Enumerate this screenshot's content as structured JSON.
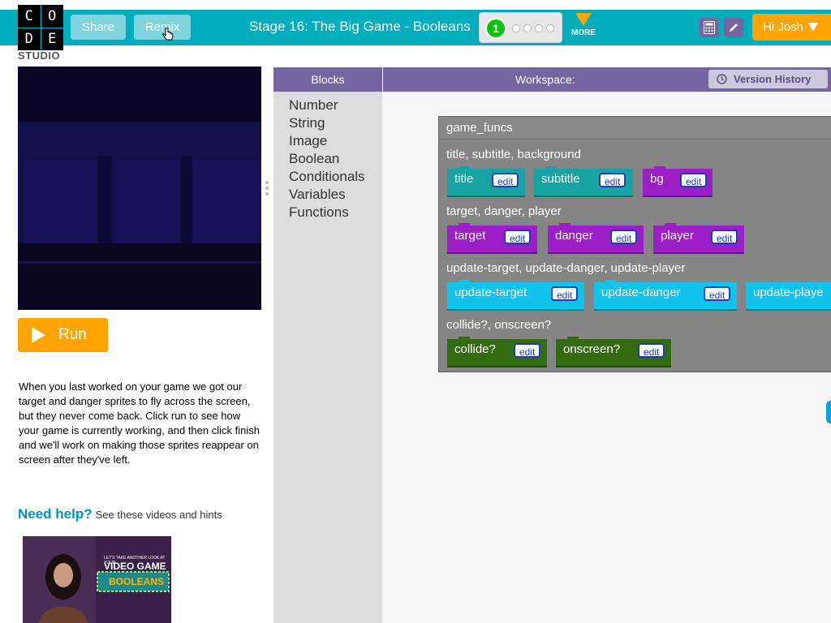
{
  "header": {
    "logo_letters": [
      "C",
      "O",
      "D",
      "E"
    ],
    "studio": "STUDIO",
    "share_label": "Share",
    "remix_label": "Remix",
    "stage_title": "Stage 16: The Big Game - Booleans",
    "progress_current": "1",
    "more_label": "MORE",
    "user_label": "Hi Josh",
    "colors": {
      "header_bg": "#00adbc",
      "accent_orange": "#ffa400",
      "purple": "#7665a0",
      "current_dot": "#0dc20d"
    }
  },
  "left": {
    "run_label": "Run",
    "instructions": "When you last worked on your game we got our target and danger sprites to fly across the screen, but they never come back. Click run to see how your game is currently working, and then click finish and we'll work on making those sprites reappear on screen after they've left.",
    "help_title": "Need help?",
    "help_sub": "See these videos and hints",
    "video": {
      "caption_line1": "LET'S TAKE ANOTHER LOOK AT YOUR",
      "caption_line2": "VIDEO GAME",
      "caption_line3": "BOOLEANS"
    }
  },
  "palette": {
    "header": "Blocks",
    "items": [
      "Number",
      "String",
      "Image",
      "Boolean",
      "Conditionals",
      "Variables",
      "Functions"
    ]
  },
  "workspace": {
    "header": "Workspace:",
    "version_history": "Version History",
    "funcs_title": "game_funcs",
    "edit_label": "edit",
    "groups": [
      {
        "label": "title, subtitle, background",
        "blocks": [
          "title",
          "subtitle",
          "bg"
        ]
      },
      {
        "label": "target, danger, player",
        "blocks": [
          "target",
          "danger",
          "player"
        ]
      },
      {
        "label": "update-target, update-danger, update-player",
        "blocks": [
          "update-target",
          "update-danger",
          "update-playe"
        ]
      },
      {
        "label": "collide?, onscreen?",
        "blocks": [
          "collide?",
          "onscreen?"
        ]
      }
    ]
  }
}
